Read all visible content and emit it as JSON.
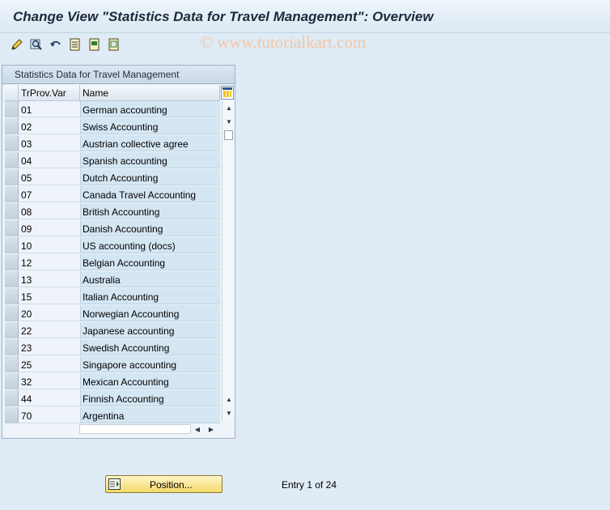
{
  "window": {
    "title": "Change View \"Statistics Data for Travel Management\": Overview",
    "watermark": "© www.tutorialkart.com"
  },
  "toolbar": {
    "icons": [
      "display-change-icon",
      "find-icon",
      "undo-icon",
      "select-all-icon",
      "select-block-icon",
      "deselect-all-icon"
    ]
  },
  "table": {
    "title": "Statistics Data for Travel Management",
    "columns": [
      "TrProv.Var",
      "Name"
    ],
    "rows": [
      {
        "code": "01",
        "name": "German accounting"
      },
      {
        "code": "02",
        "name": "Swiss Accounting"
      },
      {
        "code": "03",
        "name": "Austrian collective agree"
      },
      {
        "code": "04",
        "name": "Spanish accounting"
      },
      {
        "code": "05",
        "name": "Dutch Accounting"
      },
      {
        "code": "07",
        "name": "Canada Travel Accounting"
      },
      {
        "code": "08",
        "name": "British Accounting"
      },
      {
        "code": "09",
        "name": "Danish Accounting"
      },
      {
        "code": "10",
        "name": "US accounting (docs)"
      },
      {
        "code": "12",
        "name": "Belgian Accounting"
      },
      {
        "code": "13",
        "name": "Australia"
      },
      {
        "code": "15",
        "name": "Italian Accounting"
      },
      {
        "code": "20",
        "name": "Norwegian Accounting"
      },
      {
        "code": "22",
        "name": "Japanese accounting"
      },
      {
        "code": "23",
        "name": "Swedish Accounting"
      },
      {
        "code": "25",
        "name": "Singapore accounting"
      },
      {
        "code": "32",
        "name": "Mexican Accounting"
      },
      {
        "code": "44",
        "name": "Finnish Accounting"
      },
      {
        "code": "70",
        "name": "Argentina"
      }
    ]
  },
  "footer": {
    "position_label": "Position...",
    "entry_text": "Entry 1 of 24"
  },
  "colors": {
    "background": "#dfebf5",
    "name_cell": "#d5e6f3",
    "button": "#f4d96a"
  }
}
